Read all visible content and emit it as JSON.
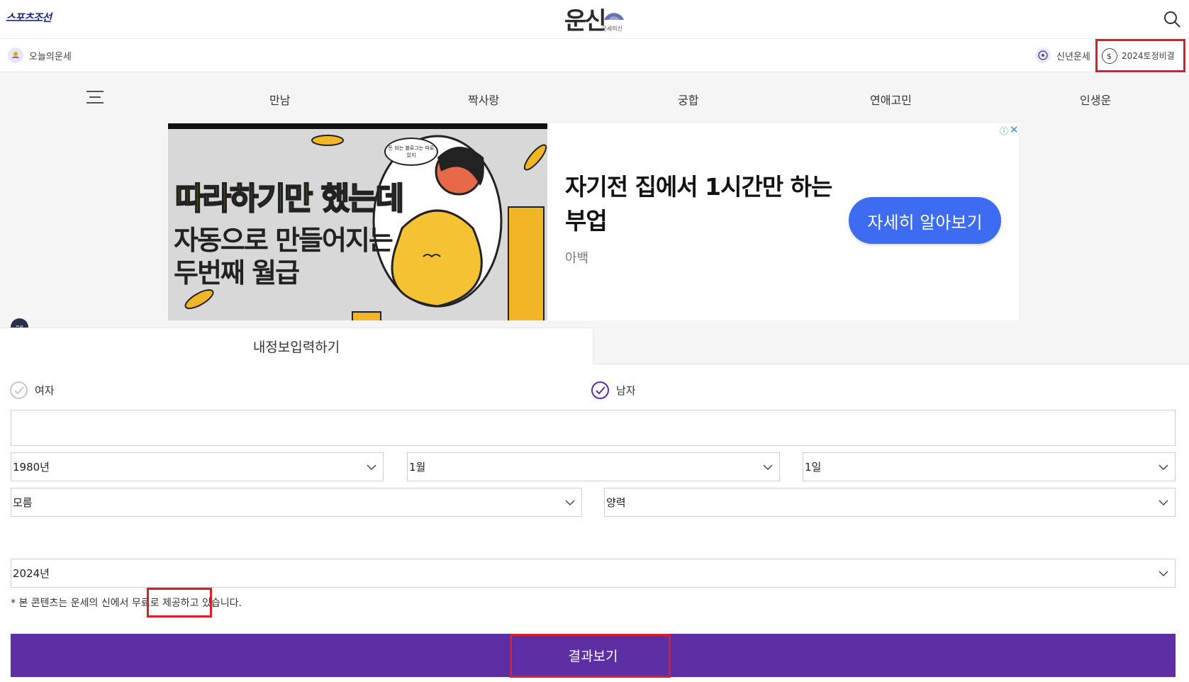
{
  "header": {
    "brand": "스포츠조선",
    "logo_text": "운신",
    "logo_sub": "운세의신",
    "search_icon": "search-icon"
  },
  "subnav": {
    "today": "오늘의운세",
    "newyear": "신년운세",
    "tojeong": "2024토정비결"
  },
  "nav": {
    "items": [
      "만남",
      "짝사랑",
      "궁합",
      "연애고민",
      "인생운"
    ]
  },
  "ad": {
    "image_line1": "따라하기만 했는데",
    "image_line2": "자동으로 만들어지는",
    "image_line3": "두번째 월급",
    "bubble": "돈 되는 블로그는 따로 있지",
    "title": "자기전 집에서 1시간만 하는부업",
    "sponsor": "아백",
    "cta": "자세히 알아보기",
    "info": "ⓘ",
    "close": "✕"
  },
  "badge": {
    "free": "무료"
  },
  "tabs": {
    "active": "내정보입력하기"
  },
  "form": {
    "gender_female": "여자",
    "gender_male": "남자",
    "selected_gender": "male",
    "name_value": "",
    "year": "1980년",
    "month": "1월",
    "day": "1일",
    "time": "모름",
    "calendar": "양력",
    "target_year": "2024년",
    "note": "* 본 콘텐츠는 운세의 신에서 무료로 제공하고 있습니다.",
    "submit": "결과보기"
  },
  "colors": {
    "purple": "#5e2ea5",
    "highlight_red": "#d9202a",
    "cta_blue": "#3d6bf2"
  }
}
